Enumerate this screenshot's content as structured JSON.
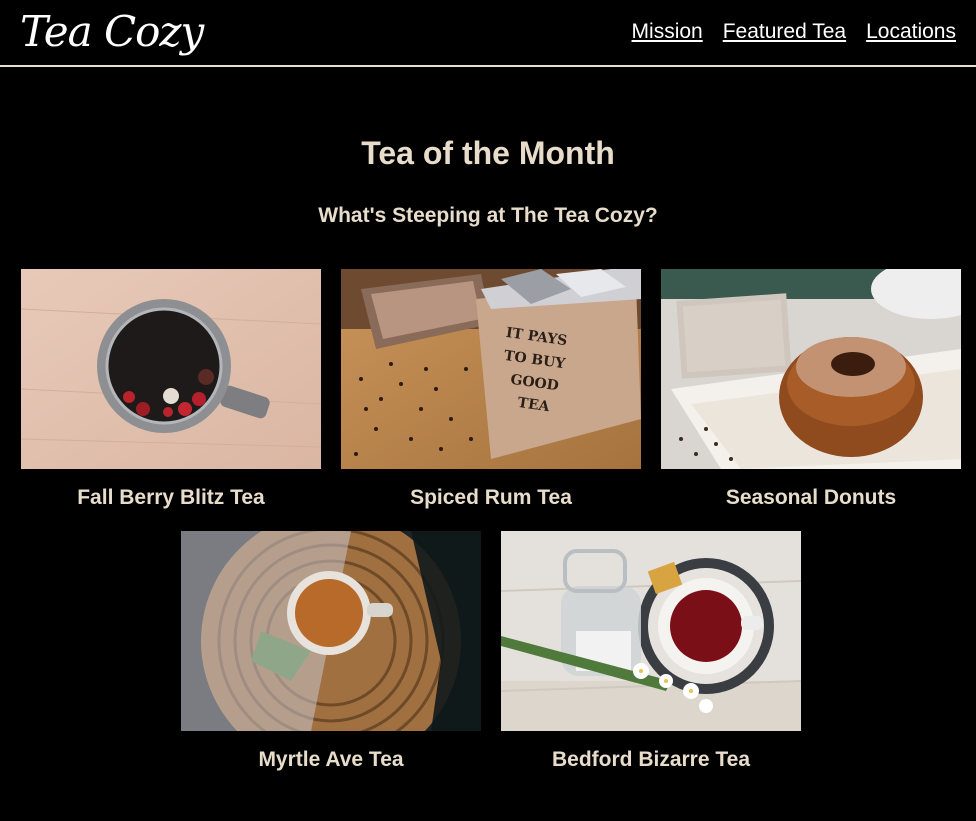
{
  "brand": {
    "logo_text": "Tea Cozy"
  },
  "nav": {
    "items": [
      {
        "label": "Mission"
      },
      {
        "label": "Featured Tea"
      },
      {
        "label": "Locations"
      }
    ]
  },
  "main": {
    "title": "Tea of the Month",
    "subtitle": "What's Steeping at The Tea Cozy?",
    "teas": [
      {
        "name": "Fall Berry Blitz Tea"
      },
      {
        "name": "Spiced Rum Tea",
        "box_text": [
          "IT PAYS",
          "TO BUY",
          "GOOD",
          "TEA"
        ]
      },
      {
        "name": "Seasonal Donuts"
      },
      {
        "name": "Myrtle Ave Tea"
      },
      {
        "name": "Bedford Bizarre Tea"
      }
    ]
  },
  "colors": {
    "background": "#000000",
    "text_accent": "#e8dccb",
    "link": "#ffffff"
  }
}
